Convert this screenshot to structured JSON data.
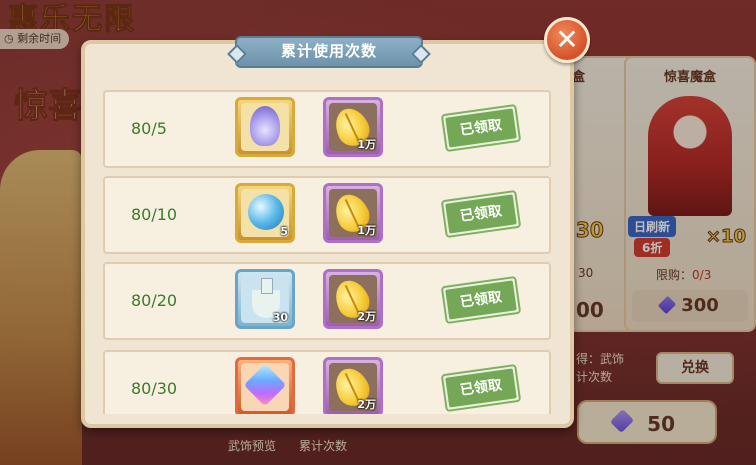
{
  "background": {
    "event_title": "惠乐无限",
    "timer_label": "剩余时间",
    "side_big_text": "惊喜",
    "card_left": {
      "title": "盒",
      "qty": "30",
      "limit": "30",
      "price": "00"
    },
    "card_right": {
      "title": "惊喜魔盒",
      "refresh_tag": "日刷新",
      "discount_tag": "6折",
      "qty": "×10",
      "limit_label": "限购：",
      "limit_value": "0/3",
      "price": "300"
    },
    "reward_line1": "得：武饰",
    "reward_line2": "计次数",
    "exchange_button": "兑换",
    "bottom_currency": "50",
    "bottom_tabs": [
      "武饰预览",
      "累计次数"
    ]
  },
  "modal": {
    "title": "累计使用次数",
    "rows": [
      {
        "label": "80/5",
        "items": [
          {
            "icon": "harp-icon",
            "frame": "gold",
            "qty": ""
          },
          {
            "icon": "leaf-icon",
            "frame": "purple",
            "qty": "1万"
          }
        ],
        "status": "已领取"
      },
      {
        "label": "80/10",
        "items": [
          {
            "icon": "orb-icon",
            "frame": "gold",
            "qty": "5"
          },
          {
            "icon": "leaf-icon",
            "frame": "purple",
            "qty": "1万"
          }
        ],
        "status": "已领取"
      },
      {
        "label": "80/20",
        "items": [
          {
            "icon": "bottle-icon",
            "frame": "blue",
            "qty": "30"
          },
          {
            "icon": "leaf-icon",
            "frame": "purple",
            "qty": "2万"
          }
        ],
        "status": "已领取"
      },
      {
        "label": "80/30",
        "items": [
          {
            "icon": "gem-icon",
            "frame": "red",
            "qty": ""
          },
          {
            "icon": "leaf-icon",
            "frame": "purple",
            "qty": "2万"
          }
        ],
        "status": "已领取"
      }
    ]
  }
}
